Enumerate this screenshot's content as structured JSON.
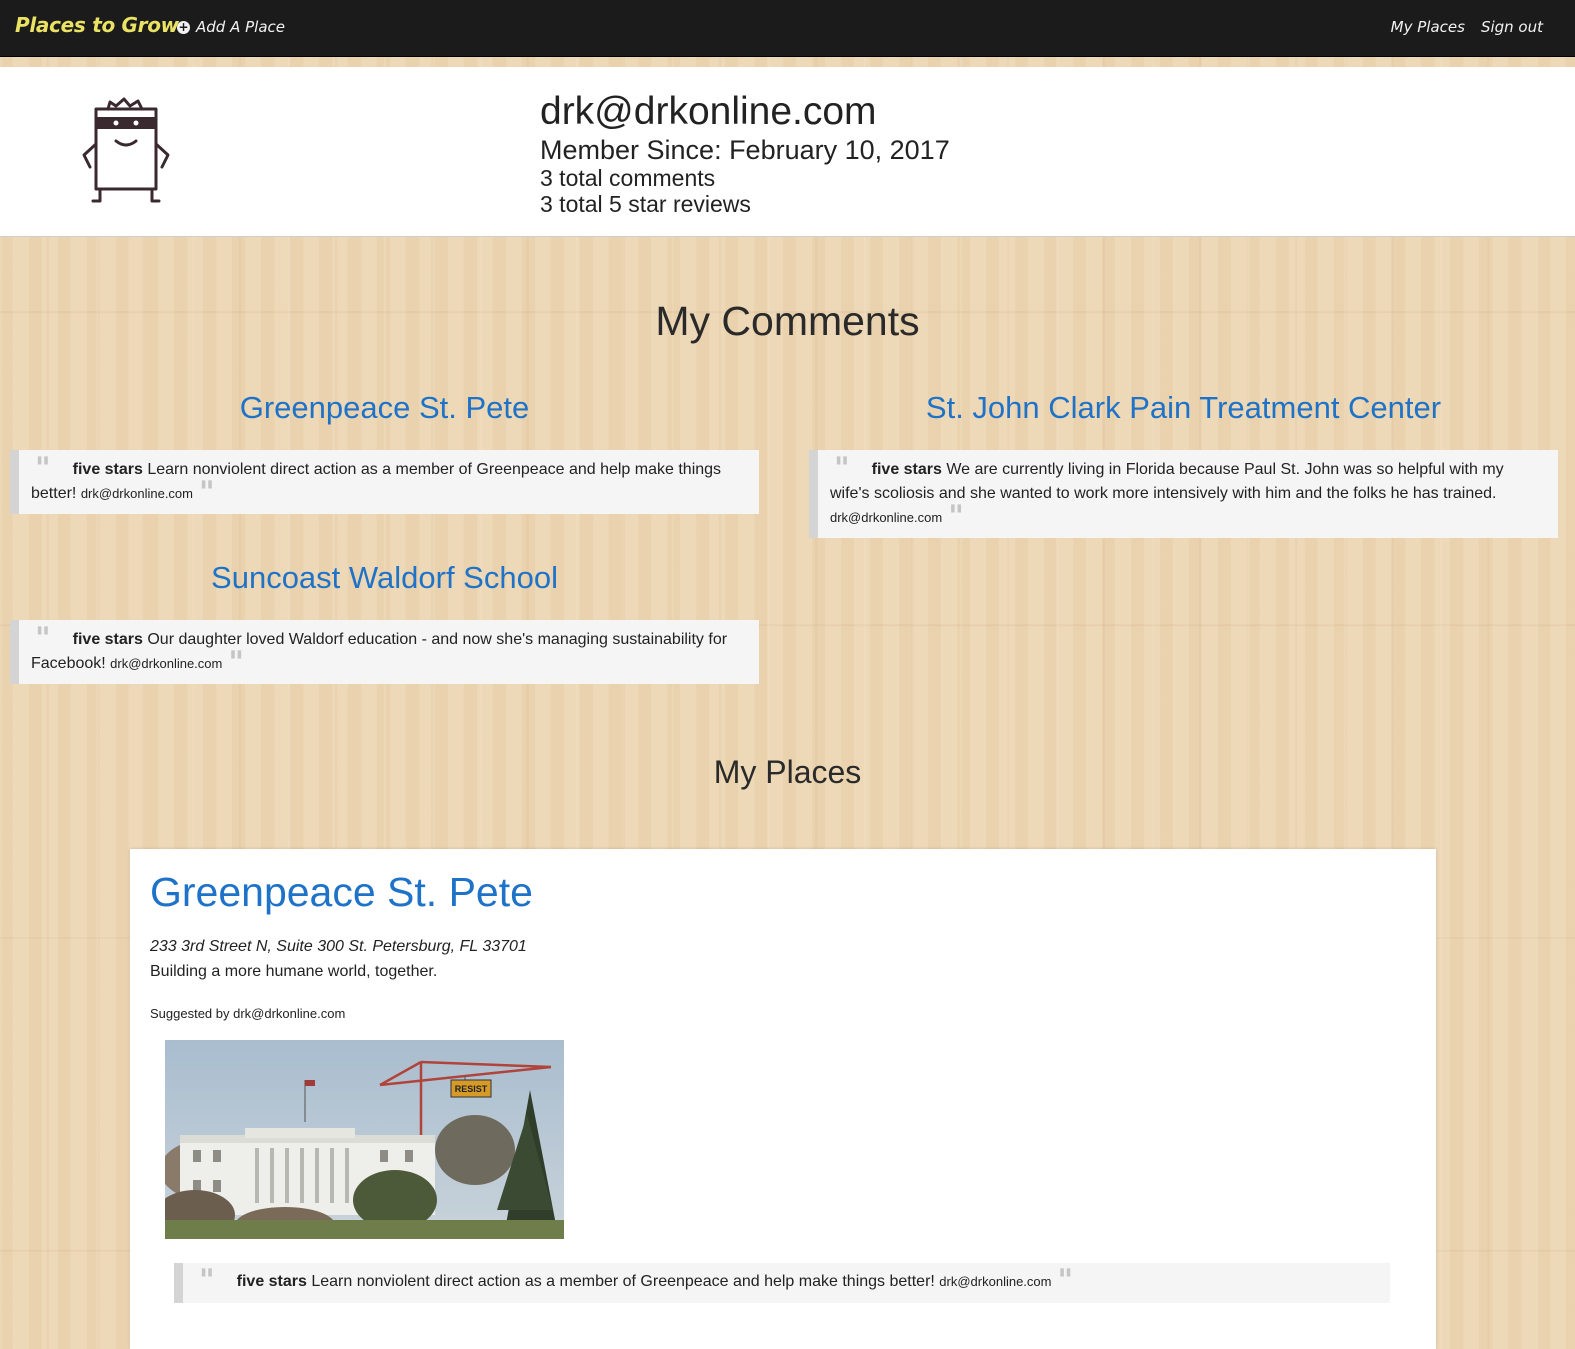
{
  "navbar": {
    "brand": "Places to Grow",
    "add_place": "Add A Place",
    "my_places": "My Places",
    "sign_out": "Sign out"
  },
  "profile": {
    "email": "drk@drkonline.com",
    "member_since": "Member Since: February 10, 2017",
    "total_comments": "3 total comments",
    "total_five_star": "3 total 5 star reviews"
  },
  "comments_section": {
    "title": "My Comments",
    "items": [
      {
        "place": "Greenpeace St. Pete",
        "rating": "five stars",
        "text": "Learn nonviolent direct action as a member of Greenpeace and help make things better!",
        "author": "drk@drkonline.com"
      },
      {
        "place": "St. John Clark Pain Treatment Center",
        "rating": "five stars",
        "text": "We are currently living in Florida because Paul St. John was so helpful with my wife's scoliosis and she wanted to work more intensively with him and the folks he has trained.",
        "author": "drk@drkonline.com"
      },
      {
        "place": "Suncoast Waldorf School",
        "rating": "five stars",
        "text": "Our daughter loved Waldorf education - and now she's managing sustainability for Facebook!",
        "author": "drk@drkonline.com"
      }
    ]
  },
  "places_section": {
    "title": "My Places",
    "place": {
      "name": "Greenpeace St. Pete",
      "address": "233 3rd Street N, Suite 300 St. Petersburg, FL 33701",
      "tagline": "Building a more humane world, together.",
      "suggested_by": "Suggested by drk@drkonline.com",
      "photo_banner": "RESIST",
      "comment": {
        "rating": "five stars",
        "text": "Learn nonviolent direct action as a member of Greenpeace and help make things better!",
        "author": "drk@drkonline.com"
      }
    }
  },
  "colors": {
    "navbar_bg": "#1b1b1b",
    "brand": "#e9e263",
    "link_blue": "#1e73c8",
    "wood_bg": "#ecd6b3"
  }
}
